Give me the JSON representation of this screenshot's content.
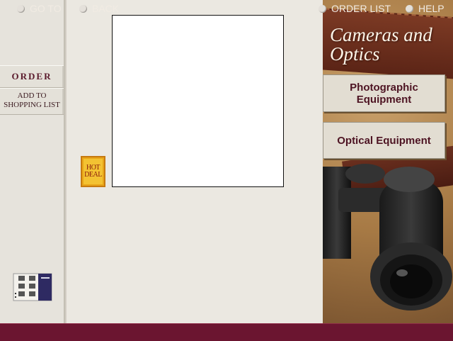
{
  "sidebar": {
    "order_label": "ORDER",
    "add_label_line1": "ADD TO",
    "add_label_line2": "SHOPPING LIST"
  },
  "badge": {
    "line1": "HOT",
    "line2": "DEAL"
  },
  "panel": {
    "title_line1": "Cameras and",
    "title_line2": "Optics",
    "categories": [
      {
        "label_line1": "Photographic",
        "label_line2": "Equipment"
      },
      {
        "label_line1": "Optical Equipment",
        "label_line2": ""
      }
    ]
  },
  "bottom_nav": {
    "goto": "GO TO",
    "back": "BACK",
    "order_list": "ORDER LIST",
    "help": "HELP"
  },
  "colors": {
    "bar": "#6b1530",
    "button_text": "#4d1322"
  },
  "icons": {
    "catalog": "catalog-grid-icon",
    "binoculars": "binoculars-image"
  }
}
